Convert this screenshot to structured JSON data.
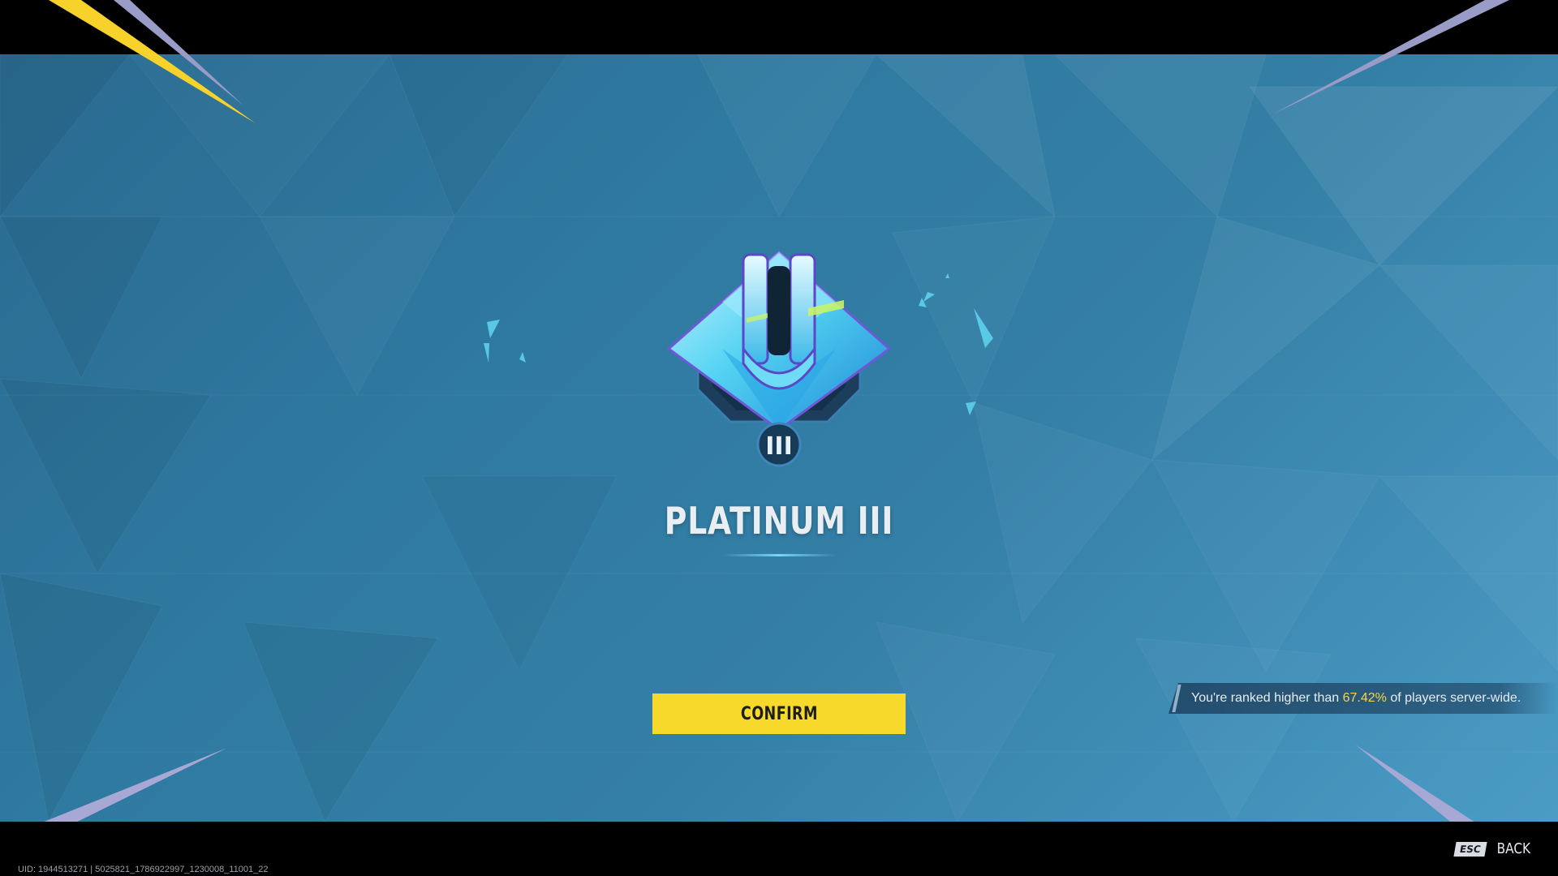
{
  "rank": {
    "tier_numeral": "III",
    "title": "PLATINUM III"
  },
  "actions": {
    "confirm_label": "CONFIRM",
    "back_key": "ESC",
    "back_label": "BACK"
  },
  "ranking_note": {
    "prefix": "You're ranked higher than ",
    "percent": "67.42%",
    "suffix": " of players server-wide."
  },
  "footer": {
    "uid": "UID: 1944513271 | 5025821_1786922997_1230008_11001_22"
  },
  "colors": {
    "accent_yellow": "#f7d92b",
    "percent_yellow": "#f6d648",
    "background_blue": "#2f7aa1",
    "emblem_cyan": "#4fd6f2"
  },
  "icons": {
    "emblem": "platinum-rank-emblem-icon"
  }
}
